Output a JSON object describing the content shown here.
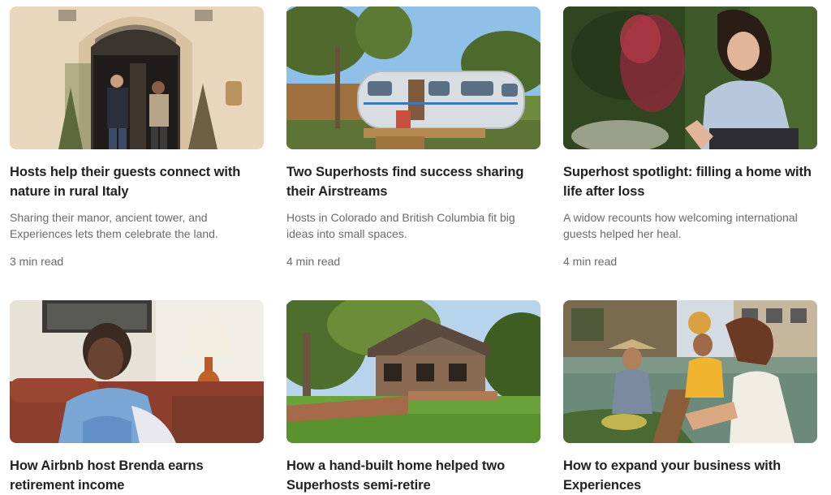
{
  "cards": [
    {
      "title": "Hosts help their guests connect with nature in rural Italy",
      "description": "Sharing their manor, ancient tower, and Experiences lets them celebrate the land.",
      "read_time": "3 min read"
    },
    {
      "title": "Two Superhosts find success sharing their Airstreams",
      "description": "Hosts in Colorado and British Columbia fit big ideas into small spaces.",
      "read_time": "4 min read"
    },
    {
      "title": "Superhost spotlight: filling a home with life after loss",
      "description": "A widow recounts how welcoming international guests helped her heal.",
      "read_time": "4 min read"
    },
    {
      "title": "How Airbnb host Brenda earns retirement income"
    },
    {
      "title": "How a hand-built home helped two Superhosts semi-retire"
    },
    {
      "title": "How to expand your business with Experiences"
    }
  ]
}
